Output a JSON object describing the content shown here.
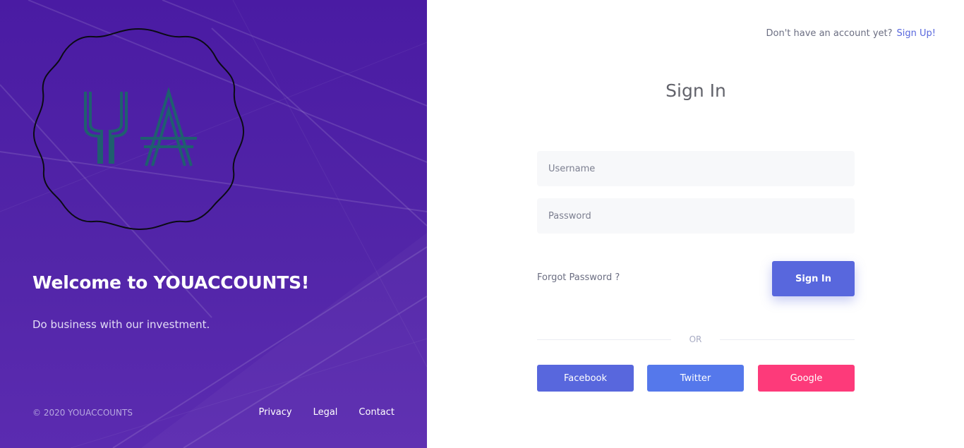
{
  "header": {
    "signup_question": "Don't have an account yet?",
    "signup_link": "Sign Up!"
  },
  "brand": {
    "logo_letters": "YA",
    "welcome": "Welcome to YOUACCOUNTS!",
    "tagline": "Do business with our investment."
  },
  "footer": {
    "copyright": "© 2020 YOUACCOUNTS",
    "links": [
      "Privacy",
      "Legal",
      "Contact"
    ]
  },
  "form": {
    "title": "Sign In",
    "username_placeholder": "Username",
    "password_placeholder": "Password",
    "forgot_label": "Forgot Password ?",
    "submit_label": "Sign In",
    "divider_label": "OR"
  },
  "social": {
    "facebook": "Facebook",
    "twitter": "Twitter",
    "google": "Google"
  },
  "colors": {
    "left_panel": "#4a1ba3",
    "accent": "#5867dd",
    "twitter": "#5578eb",
    "google": "#fd3a7a",
    "logo_letters": "#1f5f6f"
  }
}
